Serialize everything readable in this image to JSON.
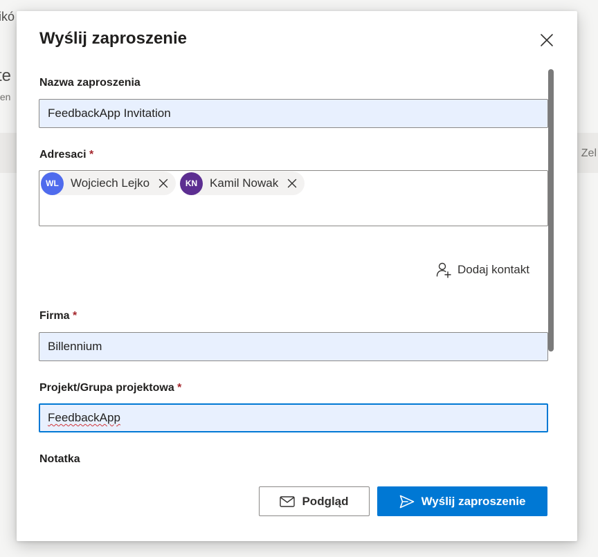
{
  "background": {
    "fragment_1": "ikó",
    "fragment_2": "te",
    "fragment_3": "ten",
    "fragment_4": "Zel"
  },
  "dialog": {
    "title": "Wyślij zaproszenie",
    "close_icon": "close-icon",
    "fields": {
      "invitation_name": {
        "label": "Nazwa zaproszenia",
        "value": "FeedbackApp Invitation"
      },
      "recipients": {
        "label": "Adresaci",
        "required_mark": "*",
        "chips": [
          {
            "initials": "WL",
            "name": "Wojciech Lejko",
            "color": "#4f6bed"
          },
          {
            "initials": "KN",
            "name": "Kamil Nowak",
            "color": "#5c2e91"
          }
        ]
      },
      "add_contact": {
        "label": "Dodaj kontakt",
        "icon": "add-person-icon"
      },
      "company": {
        "label": "Firma",
        "required_mark": "*",
        "value": "Billennium"
      },
      "project": {
        "label": "Projekt/Grupa projektowa",
        "required_mark": "*",
        "value": "FeedbackApp"
      },
      "note": {
        "label": "Notatka"
      }
    },
    "buttons": {
      "preview": {
        "label": "Podgląd",
        "icon": "mail-icon"
      },
      "send": {
        "label": "Wyślij zaproszenie",
        "icon": "send-icon"
      }
    },
    "colors": {
      "accent": "#0078d4",
      "required": "#a4262c",
      "input_fill": "#e8f0fe"
    }
  }
}
